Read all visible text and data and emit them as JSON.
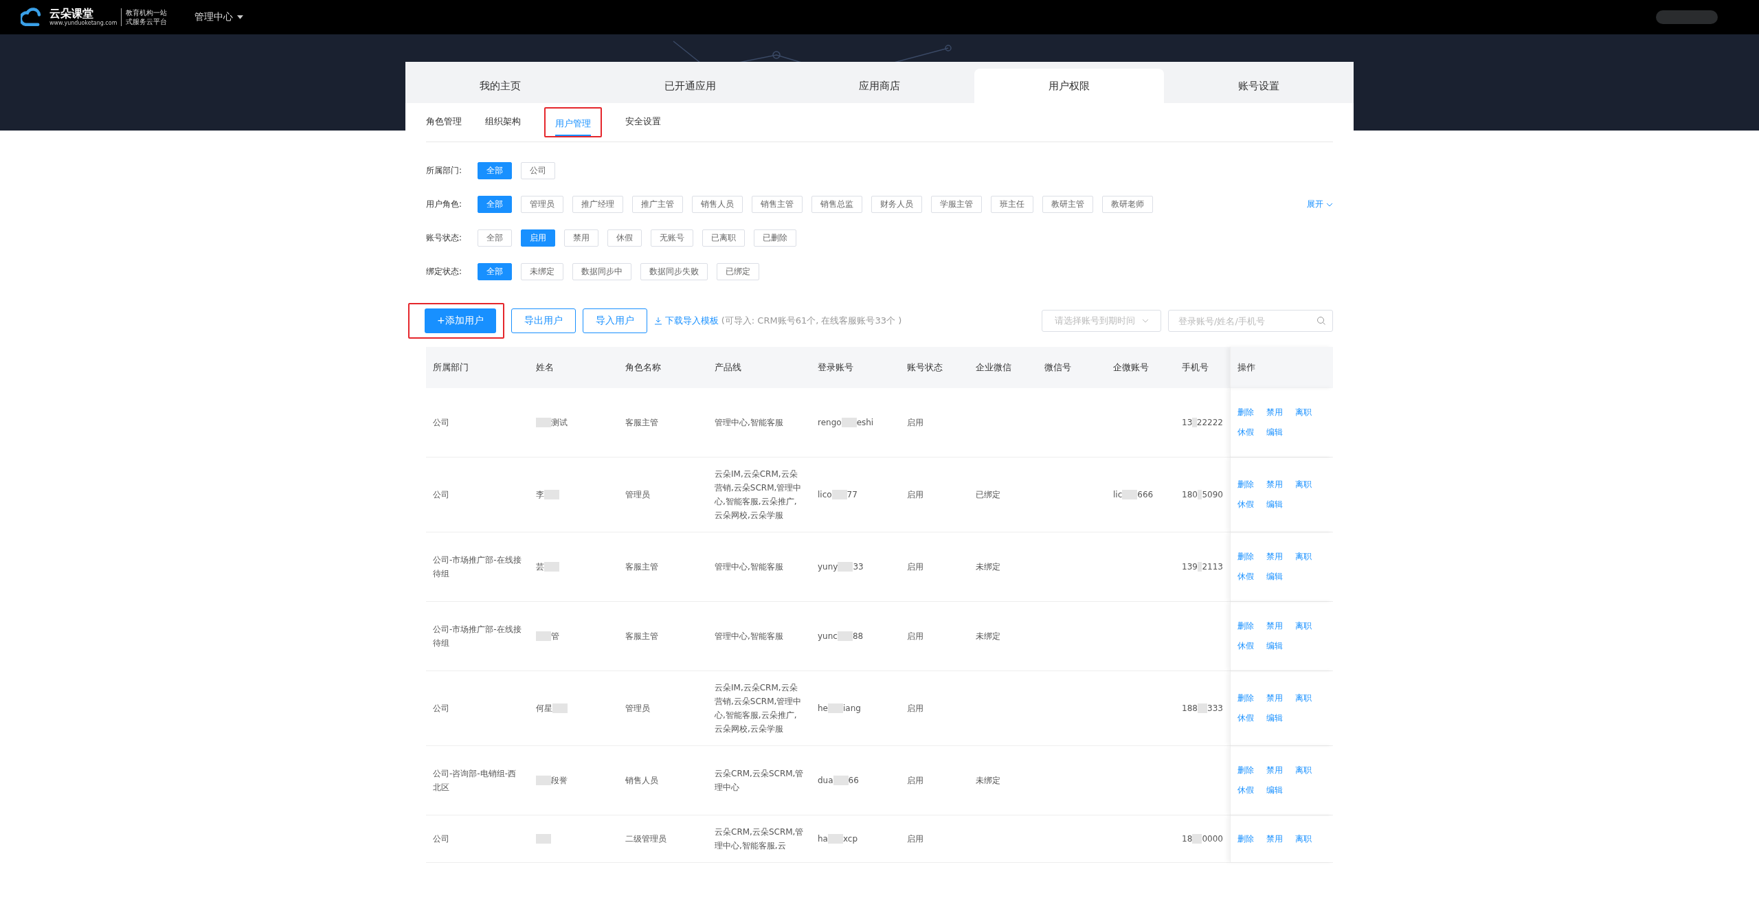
{
  "header": {
    "brand": "云朵课堂",
    "brand_url": "www.yunduoketang.com",
    "slogan_lines": [
      "教育机构一站",
      "式服务云平台"
    ],
    "menu": "管理中心"
  },
  "main_tabs": [
    {
      "label": "我的主页",
      "selected": false
    },
    {
      "label": "已开通应用",
      "selected": false
    },
    {
      "label": "应用商店",
      "selected": false
    },
    {
      "label": "用户权限",
      "selected": true
    },
    {
      "label": "账号设置",
      "selected": false
    }
  ],
  "sub_tabs": [
    {
      "label": "角色管理",
      "selected": false,
      "highlighted": false
    },
    {
      "label": "组织架构",
      "selected": false,
      "highlighted": false
    },
    {
      "label": "用户管理",
      "selected": true,
      "highlighted": true
    },
    {
      "label": "安全设置",
      "selected": false,
      "highlighted": false
    }
  ],
  "filters": [
    {
      "label": "所属部门:",
      "options": [
        {
          "label": "全部",
          "selected": true
        },
        {
          "label": "公司",
          "selected": false
        }
      ]
    },
    {
      "label": "用户角色:",
      "expand": "展开",
      "options": [
        {
          "label": "全部",
          "selected": true
        },
        {
          "label": "管理员",
          "selected": false
        },
        {
          "label": "推广经理",
          "selected": false
        },
        {
          "label": "推广主管",
          "selected": false
        },
        {
          "label": "销售人员",
          "selected": false
        },
        {
          "label": "销售主管",
          "selected": false
        },
        {
          "label": "销售总监",
          "selected": false
        },
        {
          "label": "财务人员",
          "selected": false
        },
        {
          "label": "学服主管",
          "selected": false
        },
        {
          "label": "班主任",
          "selected": false
        },
        {
          "label": "教研主管",
          "selected": false
        },
        {
          "label": "教研老师",
          "selected": false
        }
      ]
    },
    {
      "label": "账号状态:",
      "options": [
        {
          "label": "全部",
          "selected": false
        },
        {
          "label": "启用",
          "selected": true
        },
        {
          "label": "禁用",
          "selected": false
        },
        {
          "label": "休假",
          "selected": false
        },
        {
          "label": "无账号",
          "selected": false
        },
        {
          "label": "已离职",
          "selected": false
        },
        {
          "label": "已删除",
          "selected": false
        }
      ]
    },
    {
      "label": "绑定状态:",
      "options": [
        {
          "label": "全部",
          "selected": true
        },
        {
          "label": "未绑定",
          "selected": false
        },
        {
          "label": "数据同步中",
          "selected": false
        },
        {
          "label": "数据同步失败",
          "selected": false
        },
        {
          "label": "已绑定",
          "selected": false
        }
      ]
    }
  ],
  "toolbar": {
    "buttons": [
      {
        "label": "+添加用户",
        "kind": "primary",
        "highlighted": true
      },
      {
        "label": "导出用户",
        "kind": "outline",
        "highlighted": false
      },
      {
        "label": "导入用户",
        "kind": "outline",
        "highlighted": false
      }
    ],
    "template_link": "下载导入模板",
    "import_note": "(可导入: CRM账号61个, 在线客服账号33个 )",
    "expiry_select": {
      "placeholder": "请选择账号到期时间"
    },
    "search": {
      "placeholder": "登录账号/姓名/手机号"
    }
  },
  "table": {
    "columns": [
      "所属部门",
      "姓名",
      "角色名称",
      "产品线",
      "登录账号",
      "账号状态",
      "企业微信",
      "微信号",
      "企微账号",
      "手机号",
      "操作"
    ],
    "rows": [
      {
        "dept": "公司",
        "name": {
          "suffix": "测试"
        },
        "role": "客服主管",
        "products": "管理中心,智能客服",
        "account": {
          "prefix": "rengo",
          "suffix": "eshi"
        },
        "status": "启用",
        "wecom": "",
        "wechat": "",
        "wecom_account": null,
        "phone": {
          "prefix": "13",
          "suffix": "22222"
        },
        "actions": [
          "删除",
          "禁用",
          "离职",
          "休假",
          "编辑"
        ]
      },
      {
        "dept": "公司",
        "name": {
          "prefix": "李"
        },
        "role": "管理员",
        "products": "云朵IM,云朵CRM,云朵营销,云朵SCRM,管理中心,智能客服,云朵推广,云朵网校,云朵学服",
        "account": {
          "prefix": "lico",
          "suffix": "77"
        },
        "status": "启用",
        "wecom": "已绑定",
        "wechat": "",
        "wecom_account": {
          "prefix": "lic",
          "suffix": "666"
        },
        "phone": {
          "prefix": "180",
          "suffix": "5090"
        },
        "actions": [
          "删除",
          "禁用",
          "离职",
          "休假",
          "编辑"
        ]
      },
      {
        "dept": "公司-市场推广部-在线接待组",
        "name": {
          "prefix": "芸"
        },
        "role": "客服主管",
        "products": "管理中心,智能客服",
        "account": {
          "prefix": "yuny",
          "suffix": "33"
        },
        "status": "启用",
        "wecom": "未绑定",
        "wechat": "",
        "wecom_account": null,
        "phone": {
          "prefix": "139",
          "suffix": "2113"
        },
        "actions": [
          "删除",
          "禁用",
          "离职",
          "休假",
          "编辑"
        ]
      },
      {
        "dept": "公司-市场推广部-在线接待组",
        "name": {
          "suffix": "管"
        },
        "role": "客服主管",
        "products": "管理中心,智能客服",
        "account": {
          "prefix": "yunc",
          "suffix": "88"
        },
        "status": "启用",
        "wecom": "未绑定",
        "wechat": "",
        "wecom_account": null,
        "phone": null,
        "actions": [
          "删除",
          "禁用",
          "离职",
          "休假",
          "编辑"
        ]
      },
      {
        "dept": "公司",
        "name": {
          "prefix": "何星"
        },
        "role": "管理员",
        "products": "云朵IM,云朵CRM,云朵营销,云朵SCRM,管理中心,智能客服,云朵推广,云朵网校,云朵学服",
        "account": {
          "prefix": "he",
          "suffix": "iang"
        },
        "status": "启用",
        "wecom": "",
        "wechat": "",
        "wecom_account": null,
        "phone": {
          "prefix": "188",
          "suffix": "333"
        },
        "actions": [
          "删除",
          "禁用",
          "离职",
          "休假",
          "编辑"
        ]
      },
      {
        "dept": "公司-咨询部-电销组-西北区",
        "name": {
          "suffix": "段誉"
        },
        "role": "销售人员",
        "products": "云朵CRM,云朵SCRM,管理中心",
        "account": {
          "prefix": "dua",
          "suffix": "66"
        },
        "status": "启用",
        "wecom": "未绑定",
        "wechat": "",
        "wecom_account": null,
        "phone": null,
        "actions": [
          "删除",
          "禁用",
          "离职",
          "休假",
          "编辑"
        ]
      },
      {
        "dept": "公司",
        "name": {},
        "role": "二级管理员",
        "products": "云朵CRM,云朵SCRM,管理中心,智能客服,云",
        "account": {
          "prefix": "ha",
          "suffix": "xcp"
        },
        "status": "启用",
        "wecom": "",
        "wechat": "",
        "wecom_account": null,
        "phone": {
          "prefix": "18",
          "suffix": "0000"
        },
        "actions": [
          "删除",
          "禁用",
          "离职"
        ]
      }
    ]
  }
}
